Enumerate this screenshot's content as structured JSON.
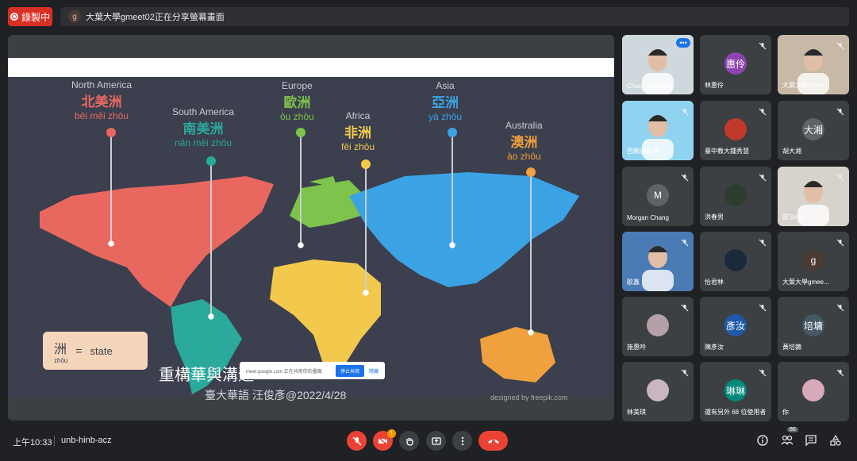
{
  "top_bar": {
    "recording_label": "錄製中",
    "presenter_avatar": "g",
    "presenting_text": "大葉大學gmeet02正在分享螢幕畫面"
  },
  "slide": {
    "continents": [
      {
        "en": "North America",
        "zh": "北美洲",
        "py": "běi měi zhōu",
        "color": "#e8685f"
      },
      {
        "en": "South America",
        "zh": "南美洲",
        "py": "nán měi zhōu",
        "color": "#2ba99a"
      },
      {
        "en": "Europe",
        "zh": "歐洲",
        "py": "ōu zhōu",
        "color": "#7dc34c"
      },
      {
        "en": "Africa",
        "zh": "非洲",
        "py": "fēi zhōu",
        "color": "#f2c94c"
      },
      {
        "en": "Asia",
        "zh": "亞洲",
        "py": "yà zhōu",
        "color": "#3ba3e4"
      },
      {
        "en": "Australia",
        "zh": "澳洲",
        "py": "ào zhōu",
        "color": "#f0a03c"
      }
    ],
    "legend": {
      "zh": "洲",
      "py": "zhōu",
      "eq": "=",
      "word": "state"
    },
    "caption_line1": "重構華與溝通",
    "caption_line2": "臺大華語 汪俊彥@2022/4/28",
    "credit": "designed by freepik.com",
    "share_banner": {
      "text": "meet.google.com 正在共用你的畫面",
      "stop": "停止共用",
      "hide": "隱藏"
    }
  },
  "participants": [
    {
      "name": "Chun-yen Wang",
      "type": "photo",
      "bg": "#cfd8dc",
      "active": true,
      "more": true
    },
    {
      "name": "林惠伶",
      "type": "avatar",
      "initial": "惠伶",
      "color": "#8e44ad"
    },
    {
      "name": "大葉大學gmee...",
      "type": "photo",
      "bg": "#c7b9a6"
    },
    {
      "name": "西雅圖大學",
      "type": "photo",
      "bg": "#8fd3f0"
    },
    {
      "name": "臺中教大鍾秀慧",
      "type": "avatar",
      "initial": "",
      "color": "#c0392b"
    },
    {
      "name": "胡大湘",
      "type": "avatar",
      "initial": "大湘",
      "color": "#5f6368"
    },
    {
      "name": "Morgan Chang",
      "type": "avatar",
      "initial": "M",
      "color": "#5f6368"
    },
    {
      "name": "洪春男",
      "type": "avatar",
      "initial": "",
      "color": "#2e3c30"
    },
    {
      "name": "歐Smile",
      "type": "photo",
      "bg": "#d6d3cc"
    },
    {
      "name": "歐鑫",
      "type": "photo",
      "bg": "#4a7bb5"
    },
    {
      "name": "怡君林",
      "type": "avatar",
      "initial": "",
      "color": "#1b2a3a"
    },
    {
      "name": "大葉大學gmee...",
      "type": "avatar",
      "initial": "g",
      "color": "#4a3b35"
    },
    {
      "name": "施惠吟",
      "type": "avatar",
      "initial": "",
      "color": "#b2a2a8"
    },
    {
      "name": "陳彥汝",
      "type": "avatar",
      "initial": "彥汝",
      "color": "#1e5aa8"
    },
    {
      "name": "黃培鑣",
      "type": "avatar",
      "initial": "培墉",
      "color": "#455a64"
    },
    {
      "name": "林美琪",
      "type": "avatar",
      "initial": "",
      "color": "#c8b6c0"
    },
    {
      "name": "還有另外 68 位使用者",
      "type": "more",
      "initial": "琳琳",
      "color": "#00897b"
    },
    {
      "name": "你",
      "type": "avatar",
      "initial": "",
      "color": "#d8a9b9"
    }
  ],
  "bottom_bar": {
    "time": "上午10:33",
    "meeting_code": "unb-hinb-acz",
    "people_count": "86",
    "camera_badge": "!"
  }
}
